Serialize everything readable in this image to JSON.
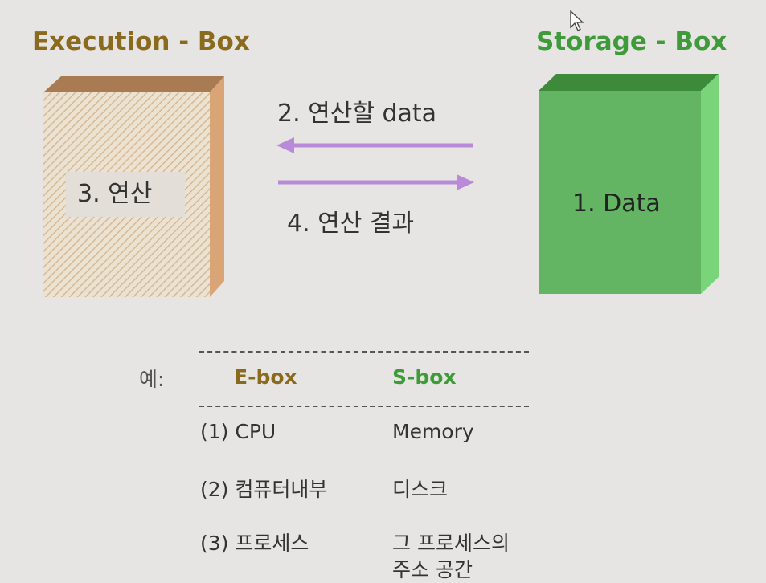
{
  "execution_box": {
    "title": "Execution - Box",
    "label": "3. 연산"
  },
  "storage_box": {
    "title": "Storage - Box",
    "label": "1. Data"
  },
  "arrows": {
    "to_execution": "2. 연산할 data",
    "to_storage": "4. 연산 결과"
  },
  "example": {
    "prefix": "예:",
    "headers": {
      "ebox": "E-box",
      "sbox": "S-box"
    },
    "rows": [
      {
        "ebox": "(1) CPU",
        "sbox": "Memory"
      },
      {
        "ebox": "(2) 컴퓨터내부",
        "sbox": "디스크"
      },
      {
        "ebox": "(3) 프로세스",
        "sbox": "그 프로세스의",
        "sbox_line2": "주소 공간"
      }
    ]
  },
  "colors": {
    "execution_accent": "#8a6a1c",
    "storage_accent": "#3f9a3a",
    "arrow": "#b88ad8",
    "background": "#e6e5e3"
  },
  "icons": {
    "cursor": "mouse-pointer-icon"
  }
}
